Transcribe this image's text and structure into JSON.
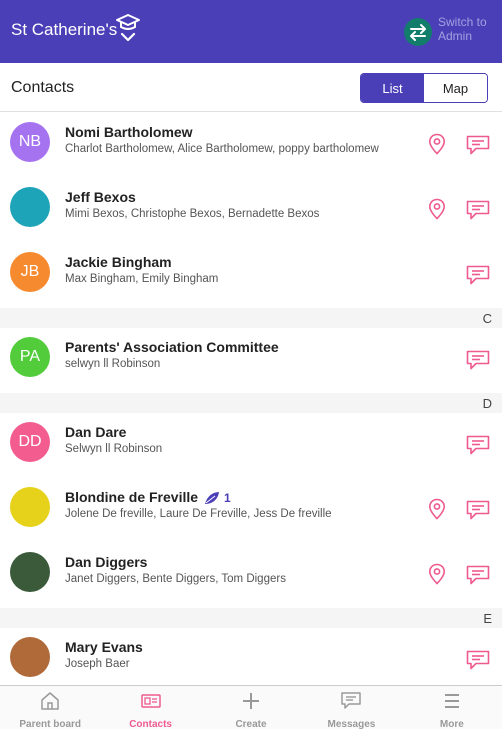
{
  "header": {
    "school_name": "St Catherine's",
    "switch_line1": "Switch to",
    "switch_line2": "Admin"
  },
  "subheader": {
    "title": "Contacts",
    "view_list": "List",
    "view_map": "Map"
  },
  "colors": {
    "brand": "#4b3fb8",
    "accent_pink": "#ee5a8f",
    "switch_green": "#127d6b"
  },
  "contacts": [
    {
      "initials": "NB",
      "avatar_color": "#a673f0",
      "name": "Nomi Bartholomew",
      "sub": "Charlot Bartholomew, Alice Bartholomew, poppy bartholomew",
      "has_location": true
    },
    {
      "initials": "",
      "avatar_color": "#1ea4b8",
      "name": "Jeff Bexos",
      "sub": "Mimi Bexos, Christophe Bexos, Bernadette Bexos",
      "has_location": true
    },
    {
      "initials": "JB",
      "avatar_color": "#f58a2e",
      "name": "Jackie Bingham",
      "sub": "Max Bingham, Emily Bingham",
      "has_location": false
    },
    {
      "section": "C"
    },
    {
      "initials": "PA",
      "avatar_color": "#52cc3a",
      "name": "Parents' Association Committee",
      "sub": "selwyn ll Robinson",
      "has_location": false
    },
    {
      "section": "D"
    },
    {
      "initials": "DD",
      "avatar_color": "#f25c8f",
      "name": "Dan Dare",
      "sub": "Selwyn ll Robinson",
      "has_location": false
    },
    {
      "initials": "",
      "avatar_color": "#e6d21a",
      "name": "Blondine de Freville",
      "badge": "1",
      "sub": "Jolene De freville, Laure De Freville, Jess De freville",
      "has_location": true
    },
    {
      "initials": "",
      "avatar_color": "#3b5a3a",
      "name": "Dan Diggers",
      "sub": "Janet Diggers, Bente Diggers, Tom Diggers",
      "has_location": true
    },
    {
      "section": "E"
    },
    {
      "initials": "",
      "avatar_color": "#b06a3a",
      "name": "Mary Evans",
      "sub": "Joseph Baer",
      "has_location": false
    }
  ],
  "tabs": [
    {
      "label": "Parent board",
      "icon": "home-icon"
    },
    {
      "label": "Contacts",
      "icon": "contacts-card-icon",
      "active": true
    },
    {
      "label": "Create",
      "icon": "plus-icon"
    },
    {
      "label": "Messages",
      "icon": "message-icon"
    },
    {
      "label": "More",
      "icon": "menu-icon"
    }
  ]
}
